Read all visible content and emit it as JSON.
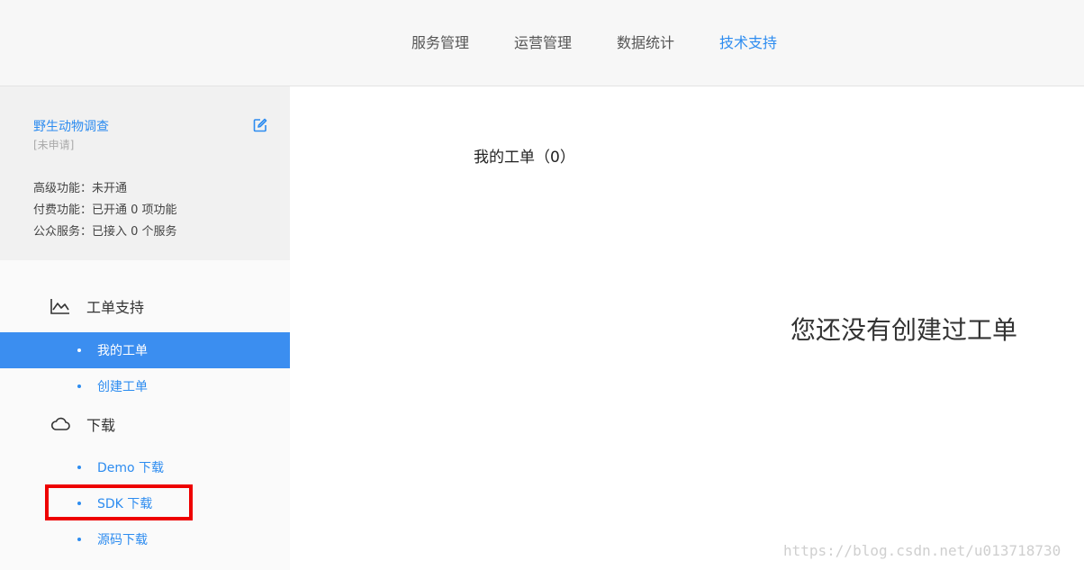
{
  "top_nav": {
    "items": [
      {
        "label": "服务管理"
      },
      {
        "label": "运营管理"
      },
      {
        "label": "数据统计"
      },
      {
        "label": "技术支持"
      }
    ],
    "active_color": "#2d8cf0"
  },
  "app_card": {
    "name": "野生动物调查",
    "status": "[未申请]",
    "info": [
      "高级功能：未开通",
      "付费功能：已开通 0 项功能",
      "公众服务：已接入 0 个服务"
    ]
  },
  "sidebar": {
    "groups": [
      {
        "title": "工单支持",
        "icon": "line-chart-icon",
        "items": [
          {
            "label": "我的工单",
            "active": true
          },
          {
            "label": "创建工单",
            "active": false
          }
        ]
      },
      {
        "title": "下载",
        "icon": "cloud-icon",
        "items": [
          {
            "label": "Demo 下载",
            "active": false
          },
          {
            "label": "SDK 下载",
            "active": false
          },
          {
            "label": "源码下载",
            "active": false
          }
        ]
      }
    ]
  },
  "main": {
    "title": "我的工单（0）",
    "empty_message": "您还没有创建过工单"
  },
  "watermark": "https://blog.csdn.net/u013718730"
}
